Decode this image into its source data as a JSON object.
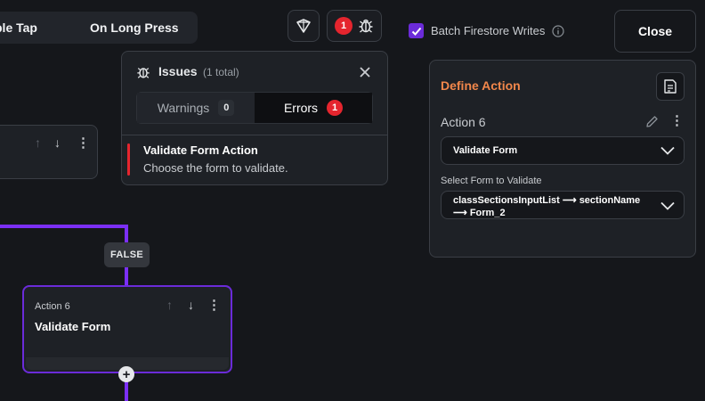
{
  "triggers": {
    "double_tap": "ble Tap",
    "long_press": "On Long Press"
  },
  "toolbar": {
    "error_count": "1"
  },
  "issues": {
    "title": "Issues",
    "total": "(1 total)",
    "tab_warnings": "Warnings",
    "warnings_count": "0",
    "tab_errors": "Errors",
    "errors_count": "1",
    "item_title": "Validate Form Action",
    "item_desc": "Choose the form to validate."
  },
  "canvas": {
    "false_label": "FALSE",
    "action_label": "Action 6",
    "action_title": "Validate Form",
    "add_symbol": "+"
  },
  "batch": {
    "label": "Batch Firestore Writes",
    "checked": true
  },
  "close_label": "Close",
  "define": {
    "title": "Define Action",
    "action_name": "Action 6",
    "action_type": "Validate Form",
    "form_label": "Select Form to Validate",
    "form_value_line1": "classSectionsInputList ⟶ sectionName",
    "form_value_line2": "⟶ Form_2"
  },
  "colors": {
    "accent": "#f2874b",
    "purple": "#6b2bd9",
    "error": "#e5252e",
    "connector": "#7b2ff7"
  }
}
